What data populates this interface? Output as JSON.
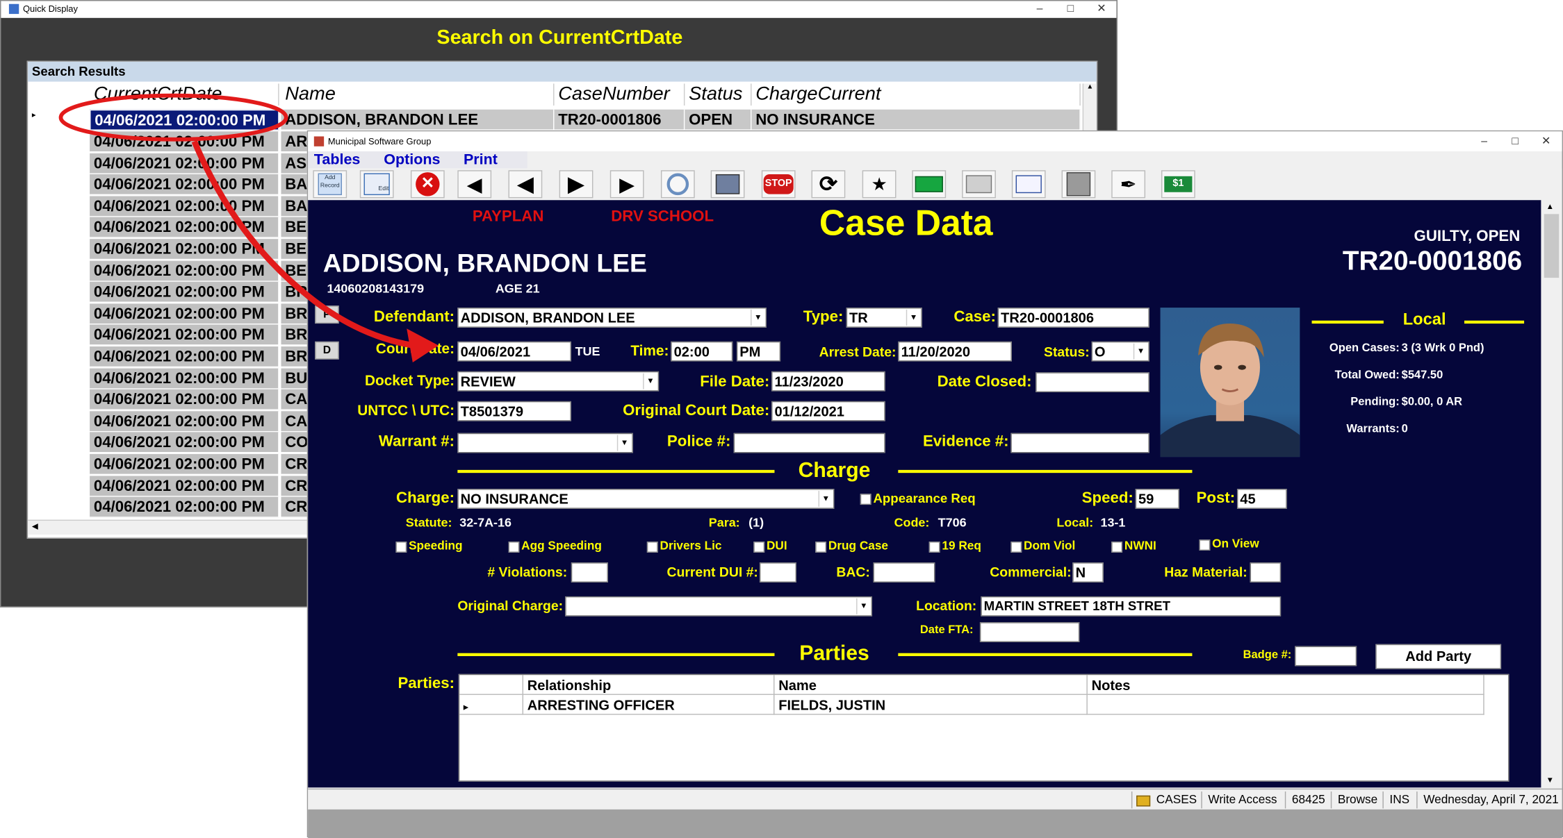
{
  "quick_display": {
    "window_title": "Quick Display",
    "heading": "Search on CurrentCrtDate",
    "results_label": "Search Results",
    "columns": [
      "CurrentCrtDate",
      "Name",
      "CaseNumber",
      "Status",
      "ChargeCurrent"
    ],
    "first_row": {
      "date": "04/06/2021 02:00:00 PM",
      "name": "ADDISON, BRANDON LEE",
      "case": "TR20-0001806",
      "status": "OPEN",
      "charge": "NO INSURANCE"
    },
    "row_dates": [
      "04/06/2021 02:00:00 PM",
      "04/06/2021 02:00:00 PM",
      "04/06/2021 02:00:00 PM",
      "04/06/2021 02:00:00 PM",
      "04/06/2021 02:00:00 PM",
      "04/06/2021 02:00:00 PM",
      "04/06/2021 02:00:00 PM",
      "04/06/2021 02:00:00 PM",
      "04/06/2021 02:00:00 PM",
      "04/06/2021 02:00:00 PM",
      "04/06/2021 02:00:00 PM",
      "04/06/2021 02:00:00 PM",
      "04/06/2021 02:00:00 PM",
      "04/06/2021 02:00:00 PM",
      "04/06/2021 02:00:00 PM",
      "04/06/2021 02:00:00 PM",
      "04/06/2021 02:00:00 PM",
      "04/06/2021 02:00:00 PM"
    ],
    "row_name_stubs": [
      "ARI",
      "ASI",
      "BAI",
      "BAI",
      "BEC",
      "BEI",
      "BEI",
      "BR",
      "BRI",
      "BRI",
      "BRI",
      "BU",
      "CAI",
      "CAI",
      "CO",
      "CRI",
      "CRI",
      "CRI"
    ]
  },
  "main_window": {
    "title": "Municipal Software Group",
    "menu": [
      "Tables",
      "Options",
      "Print"
    ],
    "toolbar_icons": [
      "add-record-icon",
      "edit-icon",
      "delete-icon",
      "first-record-icon",
      "previous-record-icon",
      "next-record-icon",
      "last-record-icon",
      "search-icon",
      "save-icon",
      "stop-icon",
      "refresh-icon",
      "people-icon",
      "table-icon",
      "printer-icon",
      "notes-icon",
      "cabinet-icon",
      "quill-icon",
      "money-icon"
    ],
    "toolbar_button_labels": {
      "add": "Add Record",
      "edit": "Edit"
    },
    "case": {
      "payplan": "PAYPLAN",
      "drv_school": "DRV SCHOOL",
      "title": "Case Data",
      "status_line": "GUILTY,  OPEN",
      "case_number_big": "TR20-0001806",
      "defendant_name": "ADDISON, BRANDON LEE",
      "id_number": "14060208143179",
      "age": "AGE  21",
      "side_buttons": [
        "P",
        "D"
      ]
    },
    "form": {
      "defendant_label": "Defendant:",
      "defendant": "ADDISON, BRANDON LEE",
      "type_label": "Type:",
      "type": "TR",
      "case_label": "Case:",
      "case": "TR20-0001806",
      "court_date_label": "Court Date:",
      "court_date": "04/06/2021",
      "court_day": "TUE",
      "time_label": "Time:",
      "time": "02:00",
      "ampm": "PM",
      "arrest_date_label": "Arrest Date:",
      "arrest_date": "11/20/2020",
      "status_label": "Status:",
      "status": "O",
      "docket_type_label": "Docket Type:",
      "docket_type": "REVIEW",
      "file_date_label": "File Date:",
      "file_date": "11/23/2020",
      "date_closed_label": "Date Closed:",
      "date_closed": "",
      "untcc_label": "UNTCC \\ UTC:",
      "untcc": "T8501379",
      "orig_court_date_label": "Original Court Date:",
      "orig_court_date": "01/12/2021",
      "warrant_label": "Warrant #:",
      "warrant": "",
      "police_label": "Police #:",
      "police": "",
      "evidence_label": "Evidence #:",
      "evidence": ""
    },
    "local": {
      "heading": "Local",
      "open_cases_label": "Open Cases:",
      "open_cases": "3 (3 Wrk  0 Pnd)",
      "total_owed_label": "Total Owed:",
      "total_owed": "$547.50",
      "pending_label": "Pending:",
      "pending": "$0.00,  0 AR",
      "warrants_label": "Warrants:",
      "warrants": "0"
    },
    "charge": {
      "heading": "Charge",
      "charge_label": "Charge:",
      "charge": "NO INSURANCE",
      "appearance_req": "Appearance Req",
      "speed_label": "Speed:",
      "speed": "59",
      "post_label": "Post:",
      "post": "45",
      "statute_label": "Statute:",
      "statute": "32-7A-16",
      "para_label": "Para:",
      "para": "(1)",
      "code_label": "Code:",
      "code": "T706",
      "local_label": "Local:",
      "local": "13-1",
      "checkboxes": [
        "Speeding",
        "Agg Speeding",
        "Drivers Lic",
        "DUI",
        "Drug Case",
        "19 Req",
        "Dom Viol",
        "NWNI",
        "On View"
      ],
      "violations_label": "# Violations:",
      "violations": "",
      "current_dui_label": "Current DUI #:",
      "current_dui": "",
      "bac_label": "BAC:",
      "bac": "",
      "commercial_label": "Commercial:",
      "commercial": "N",
      "haz_label": "Haz Material:",
      "haz": "",
      "orig_charge_label": "Original Charge:",
      "orig_charge": "",
      "location_label": "Location:",
      "location": "MARTIN STREET   18TH STRET",
      "date_fta_label": "Date FTA:",
      "date_fta": ""
    },
    "parties": {
      "heading": "Parties",
      "badge_label": "Badge #:",
      "badge": "",
      "add_party": "Add Party",
      "label": "Parties:",
      "columns": [
        "Relationship",
        "Name",
        "Notes"
      ],
      "rows": [
        {
          "relationship": "ARRESTING OFFICER",
          "name": "FIELDS, JUSTIN",
          "notes": ""
        }
      ]
    },
    "status_bar": [
      "CASES",
      "Write Access",
      "68425",
      "Browse",
      "INS",
      "Wednesday, April 7, 2021"
    ]
  }
}
